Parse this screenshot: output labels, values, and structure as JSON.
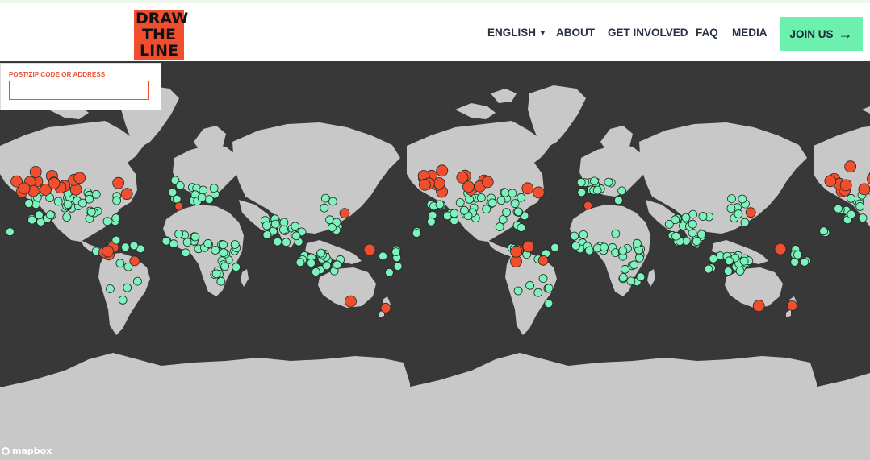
{
  "header": {
    "logo_lines": [
      "DRAW",
      "THE",
      "LINE"
    ],
    "nav": [
      {
        "label": "ENGLISH",
        "caret": "▼"
      },
      {
        "label": "ABOUT"
      },
      {
        "label": "GET INVOLVED"
      },
      {
        "label": "FAQ"
      },
      {
        "label": "MEDIA"
      }
    ],
    "join_label": "JOIN US",
    "join_arrow": "→"
  },
  "search": {
    "label": "POST/ZIP CODE OR ADDRESS",
    "value": "",
    "placeholder": ""
  },
  "map": {
    "attribution": "mapbox",
    "colors": {
      "water": "#383838",
      "land": "#c8c8c8",
      "event_marker": "#7df2bd",
      "highlight_marker": "#f04e2f"
    }
  }
}
